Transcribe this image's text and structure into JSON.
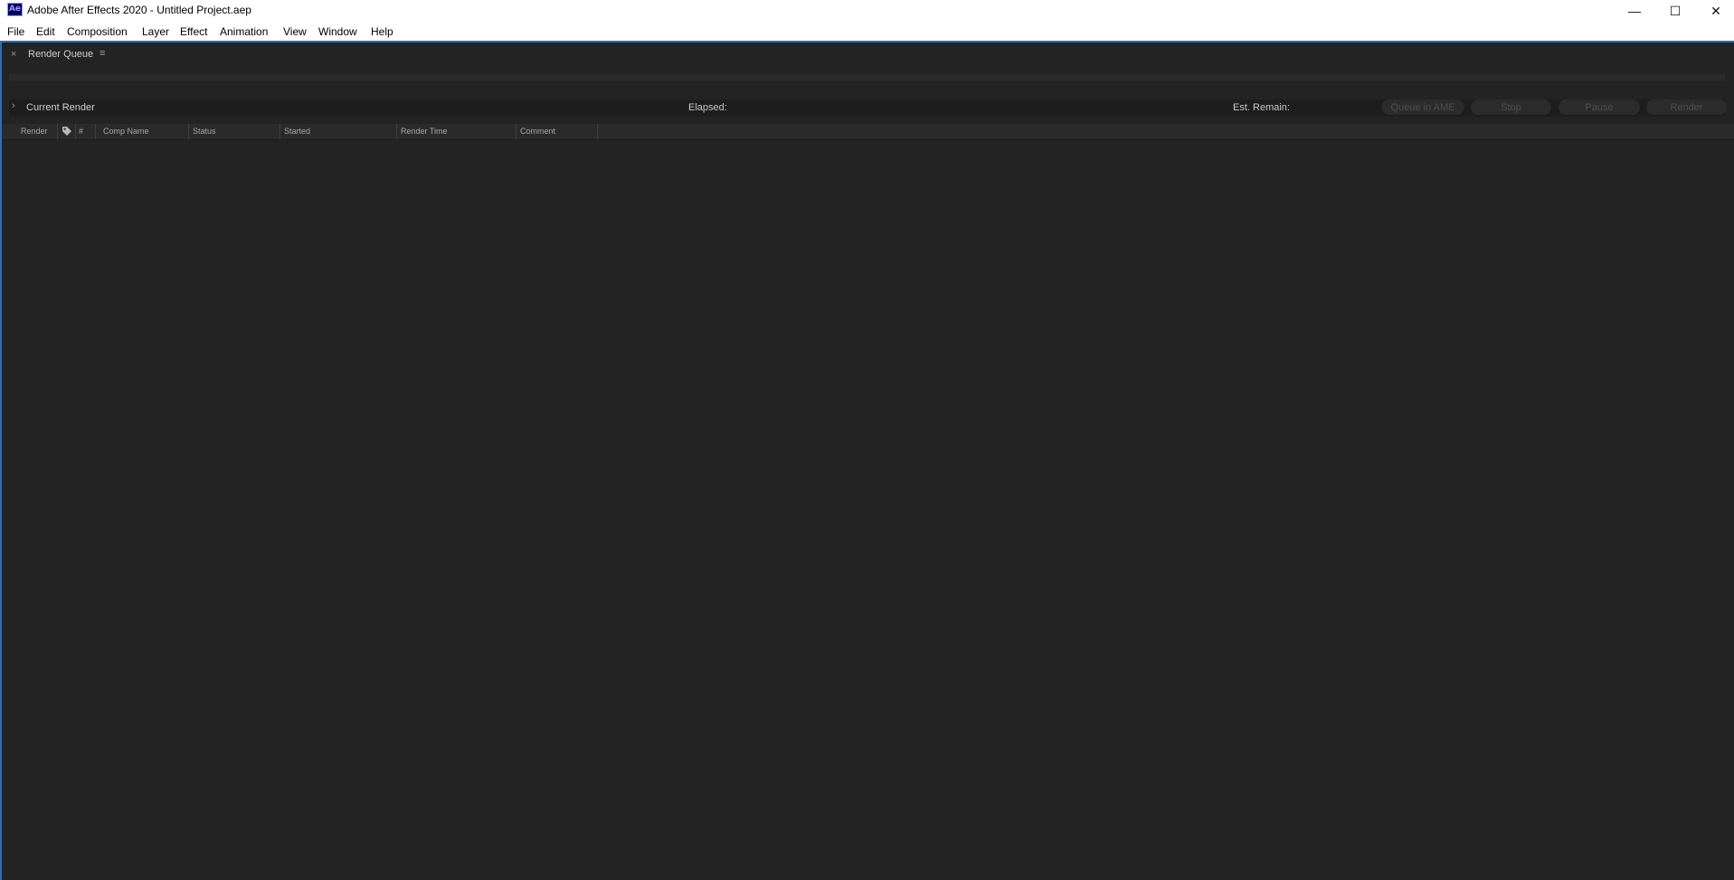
{
  "window": {
    "app_icon_label": "Ae",
    "title": "Adobe After Effects 2020 - Untitled Project.aep",
    "minimize_glyph": "—",
    "maximize_glyph": "☐",
    "close_glyph": "✕"
  },
  "menu": [
    "File",
    "Edit",
    "Composition",
    "Layer",
    "Effect",
    "Animation",
    "View",
    "Window",
    "Help"
  ],
  "panel": {
    "close_glyph": "×",
    "title": "Render Queue",
    "menu_glyph": "≡"
  },
  "current_render": {
    "chevron": "›",
    "label": "Current Render",
    "elapsed_label": "Elapsed:",
    "remain_label": "Est. Remain:"
  },
  "buttons": {
    "queue_ame": "Queue in AME",
    "stop": "Stop",
    "pause": "Pause",
    "render": "Render"
  },
  "columns": {
    "render": "Render",
    "label_icon": "tag-icon",
    "number": "#",
    "comp_name": "Comp Name",
    "status": "Status",
    "started": "Started",
    "render_time": "Render Time",
    "comment": "Comment"
  },
  "colors": {
    "panel_bg": "#232323",
    "accent": "#2c6fb4",
    "app_icon_bg": "#00005b",
    "app_icon_fg": "#9999ff"
  }
}
